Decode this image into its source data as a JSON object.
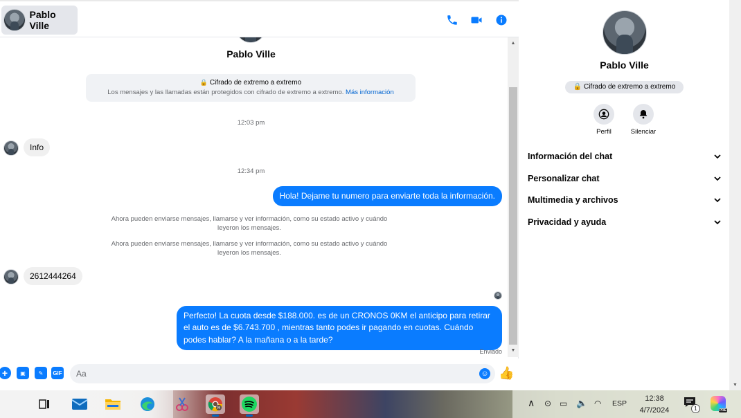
{
  "header": {
    "contact_name": "Pablo Ville",
    "icons": [
      "phone-icon",
      "video-icon",
      "info-icon"
    ]
  },
  "thread": {
    "name": "Pablo Ville",
    "e2e_title": "Cifrado de extremo a extremo",
    "e2e_text": "Los mensajes y las llamadas están protegidos con cifrado de extremo a extremo.",
    "e2e_link": "Más información",
    "messages": [
      {
        "type": "timestamp",
        "text": "12:03 pm"
      },
      {
        "type": "incoming",
        "text": "Info"
      },
      {
        "type": "timestamp",
        "text": "12:34 pm"
      },
      {
        "type": "outgoing",
        "text": "Hola! Dejame tu numero  para enviarte toda la información."
      },
      {
        "type": "system",
        "text": "Ahora pueden enviarse mensajes, llamarse y ver información, como su estado activo y cuándo leyeron los mensajes."
      },
      {
        "type": "system",
        "text": "Ahora pueden enviarse mensajes, llamarse y ver información, como su estado activo y cuándo leyeron los mensajes."
      },
      {
        "type": "incoming",
        "text": "2612444264"
      },
      {
        "type": "outgoing",
        "text": "Perfecto! La cuota desde $188.000. es de un CRONOS 0KM el anticipo para retirar el auto es de $6.743.700 , mientras tanto podes ir pagando en cuotas. Cuándo podes hablar? A la mañana o a la tarde?"
      }
    ],
    "sent_status": "Enviado"
  },
  "composer": {
    "placeholder": "Aa",
    "gif_label": "GIF"
  },
  "info_panel": {
    "name": "Pablo Ville",
    "badge": "Cifrado de extremo a extremo",
    "actions": [
      {
        "label": "Perfil",
        "icon": "profile-icon"
      },
      {
        "label": "Silenciar",
        "icon": "bell-icon"
      }
    ],
    "sections": [
      "Información del chat",
      "Personalizar chat",
      "Multimedia y archivos",
      "Privacidad y ayuda"
    ]
  },
  "taskbar": {
    "apps": [
      "task-view-icon",
      "mail-icon",
      "file-explorer-icon",
      "edge-icon",
      "snipping-tool-icon",
      "chrome-icon",
      "spotify-icon"
    ],
    "active_apps": [
      "chrome-icon",
      "spotify-icon"
    ],
    "language": "ESP",
    "time": "12:38",
    "date": "4/7/2024",
    "notification_count": "1",
    "copilot_badge": "PRE"
  },
  "colors": {
    "accent": "#0a7cff",
    "bubble_in": "#f0f0f0",
    "panel_bg": "#ffffff"
  }
}
